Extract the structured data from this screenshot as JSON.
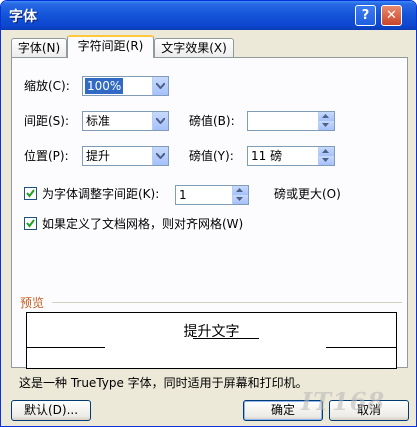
{
  "window": {
    "title": "字体"
  },
  "tabs": [
    {
      "label": "字体(N)"
    },
    {
      "label": "字符间距(R)"
    },
    {
      "label": "文字效果(X)"
    }
  ],
  "scale": {
    "label": "缩放(C):",
    "value": "100%"
  },
  "spacing": {
    "label": "间距(S):",
    "value": "标准",
    "pt_label": "磅值(B):",
    "pt_value": ""
  },
  "position": {
    "label": "位置(P):",
    "value": "提升",
    "pt_label": "磅值(Y):",
    "pt_value": "11 磅"
  },
  "kerning": {
    "label": "为字体调整字间距(K):",
    "checked": true,
    "value": "1",
    "suffix": "磅或更大(O)"
  },
  "grid": {
    "label": "如果定义了文档网格，则对齐网格(W)",
    "checked": true
  },
  "preview": {
    "title": "预览",
    "sample": "提升文字"
  },
  "note": "这是一种 TrueType 字体，同时适用于屏幕和打印机。",
  "buttons": {
    "default": "默认(D)...",
    "ok": "确定",
    "cancel": "取消"
  },
  "watermark": "IT168",
  "colors": {
    "titlebar": "#0d47cf",
    "group_title": "#c65d21",
    "selection": "#316ac5"
  }
}
